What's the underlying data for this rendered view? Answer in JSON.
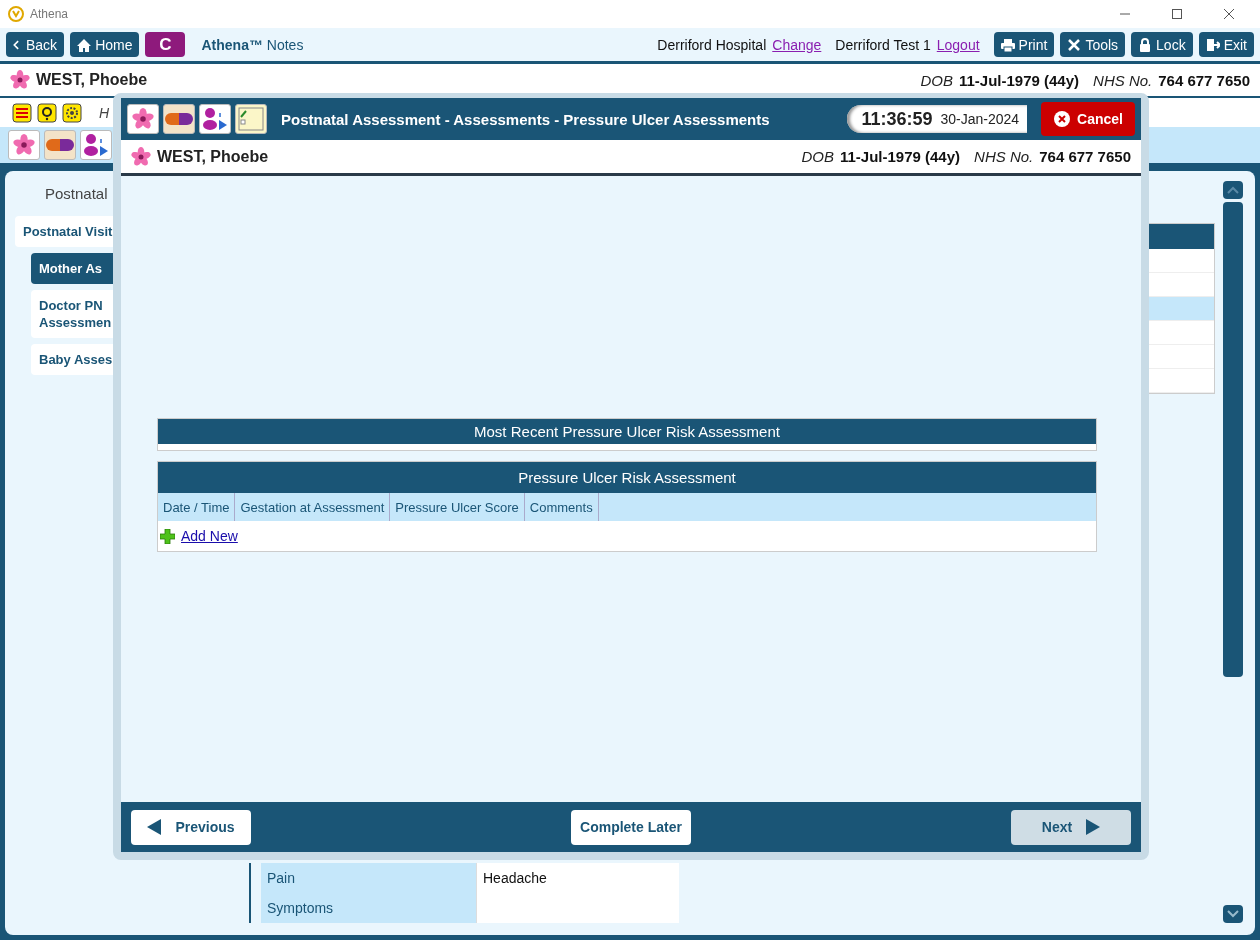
{
  "window": {
    "title": "Athena"
  },
  "toolbar": {
    "nav_buttons": [
      {
        "kind": "back",
        "label": "Back"
      },
      {
        "kind": "home",
        "label": "Home"
      },
      {
        "kind": "badge",
        "label": "C"
      }
    ],
    "app_name": "**Athena™** Notes",
    "location": "Derriford Hospital",
    "location_link": "Change",
    "user": "Derriford Test 1",
    "user_link": "Logout",
    "actions": [
      {
        "kind": "print",
        "label": "Print"
      },
      {
        "kind": "tools",
        "label": "Tools"
      },
      {
        "kind": "lock",
        "label": "Lock"
      },
      {
        "kind": "exit",
        "label": "Exit"
      }
    ]
  },
  "patient_bar": {
    "name": "WEST, Phoebe",
    "dob_label": "DOB",
    "dob": "11-Jul-1979 (44y)",
    "nhs_label": "NHS No.",
    "nhs": "764 677 7650"
  },
  "alert_bar": {
    "text": "H"
  },
  "sidebar": {
    "heading": "Postnatal",
    "items": [
      {
        "label": "Postnatal Visit",
        "selected": false,
        "children": [
          {
            "label": "Mother As",
            "selected": true
          },
          {
            "label": "Doctor PN Assessmen",
            "selected": false
          },
          {
            "label": "Baby Asses",
            "selected": false
          }
        ]
      }
    ]
  },
  "background_table": {
    "rows": [
      {
        "selected": false
      },
      {
        "selected": false
      },
      {
        "selected": true
      },
      {
        "selected": false
      },
      {
        "selected": false
      },
      {
        "selected": false
      }
    ]
  },
  "details_table": {
    "rows": [
      {
        "label": "Pain",
        "value": "Headache"
      },
      {
        "label": "Symptoms"
      }
    ]
  },
  "dialog": {
    "title": "Postnatal Assessment - Assessments - Pressure Ulcer Assessments",
    "time": "11:36:59",
    "date": "30-Jan-2024",
    "cancel": "Cancel",
    "patient_bar": {
      "name": "WEST, Phoebe",
      "dob_label": "DOB",
      "dob": "11-Jul-1979 (44y)",
      "nhs_label": "NHS No.",
      "nhs": "764 677 7650"
    },
    "recent_panel": {
      "title": "Most Recent Pressure Ulcer Risk Assessment"
    },
    "assessment_table": {
      "title": "Pressure Ulcer Risk Assessment",
      "columns": [
        "Date / Time",
        "Gestation at Assessment",
        "Pressure Ulcer Score",
        "Comments"
      ],
      "add_link": "Add New"
    },
    "footer_buttons": [
      {
        "kind": "previous",
        "label": "Previous",
        "disabled": false
      },
      {
        "kind": "plain",
        "label": "Complete Later",
        "disabled": false
      },
      {
        "kind": "next",
        "label": "Next",
        "disabled": true
      }
    ]
  }
}
